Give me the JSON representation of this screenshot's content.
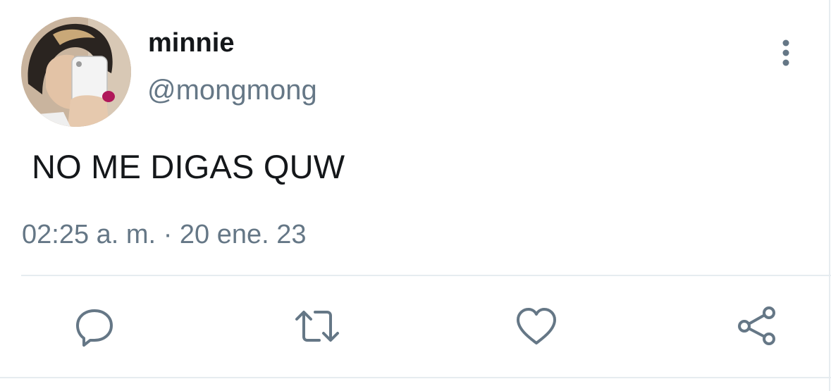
{
  "tweet": {
    "author": {
      "display_name": "minnie",
      "handle": "@mongmong"
    },
    "text": "NO ME DIGAS QUW",
    "time": "02:25 a. m.",
    "separator": "·",
    "date": "20 ene. 23"
  },
  "icons": {
    "more": "more-vertical-icon",
    "reply": "reply-icon",
    "retweet": "retweet-icon",
    "like": "heart-icon",
    "share": "share-icon"
  },
  "colors": {
    "text_primary": "#14171a",
    "text_secondary": "#657786",
    "icon": "#657786",
    "divider": "#e6ecf0"
  }
}
